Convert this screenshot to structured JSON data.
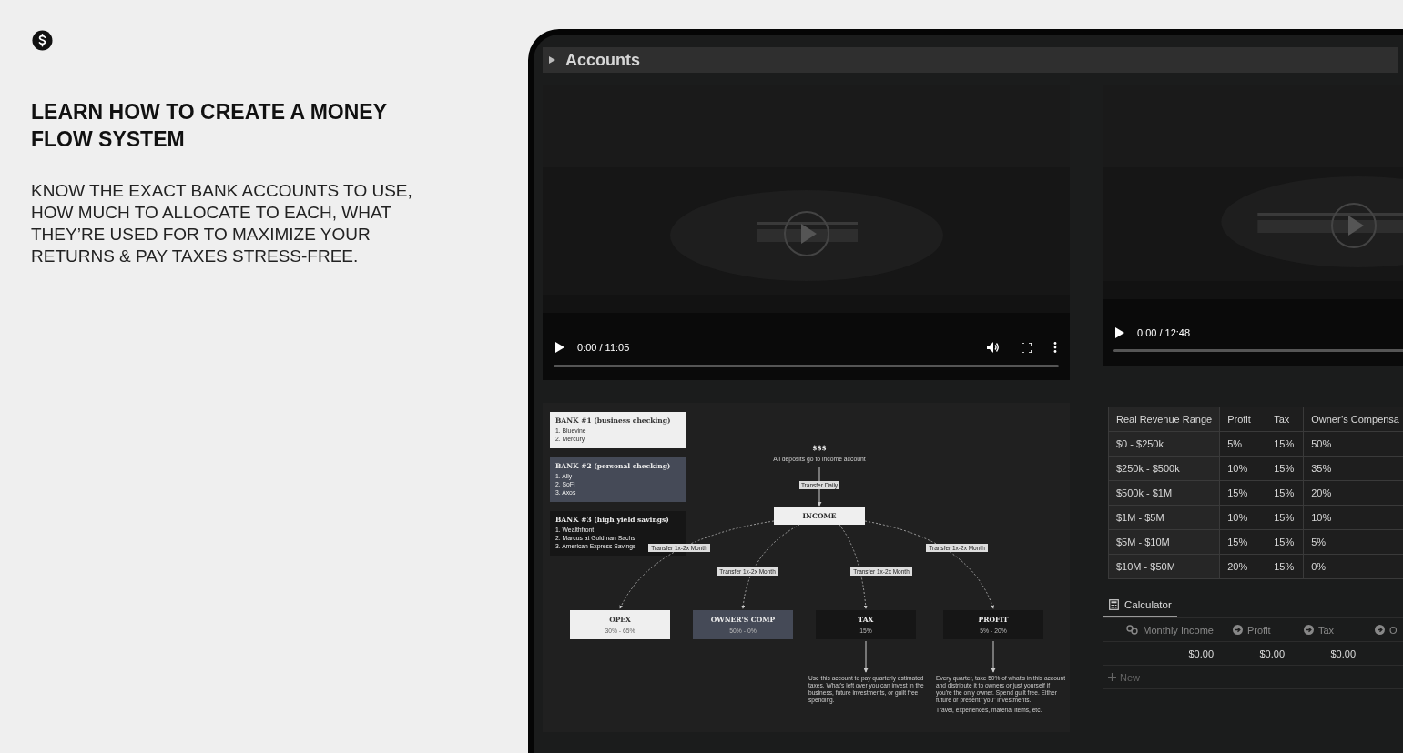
{
  "intro": {
    "heading": "LEARN HOW TO CREATE A MONEY FLOW SYSTEM",
    "body": "KNOW THE EXACT BANK ACCOUNTS TO USE, HOW MUCH TO ALLOCATE TO EACH, WHAT THEY’RE USED FOR TO MAXIMIZE YOUR RETURNS & PAY TAXES STRESS-FREE."
  },
  "toggle": {
    "title": "Accounts",
    "expanded": false
  },
  "videos": [
    {
      "kind": "picture",
      "time": "0:00 / 11:05"
    },
    {
      "kind": "picture",
      "time": "0:00 / 12:48"
    }
  ],
  "diagram": {
    "banks": [
      {
        "title": "BANK #1 (business checking)",
        "kind": "light",
        "items": [
          "1. Bluevine",
          "2. Mercury"
        ]
      },
      {
        "title": "BANK #2 (personal checking)",
        "kind": "slate",
        "items": [
          "1. Ally",
          "2. SoFi",
          "3. Axos"
        ]
      },
      {
        "title": "BANK #3 (high yield savings)",
        "kind": "dark",
        "items": [
          "1. Wealthfront",
          "2. Marcus at Goldman Sachs",
          "3. American Express Savings"
        ]
      }
    ],
    "source": {
      "title": "$$$",
      "note": "All deposits go to income account",
      "transfer": "Transfer Daily"
    },
    "income": "INCOME",
    "nodes": [
      {
        "title": "OPEX",
        "range": "30% - 65%",
        "kind": "light",
        "transfer": "Transfer 1x-2x Month"
      },
      {
        "title": "OWNER'S COMP",
        "range": "50% - 0%",
        "kind": "slate",
        "transfer": "Transfer 1x-2x Month"
      },
      {
        "title": "TAX",
        "range": "15%",
        "kind": "dark",
        "transfer": "Transfer 1x-2x Month",
        "notes": [
          "Use this account to pay quarterly estimated taxes. What's left over you can invest in the business, future investments, or guilt free spending."
        ]
      },
      {
        "title": "PROFIT",
        "range": "5% - 20%",
        "kind": "dark",
        "transfer": "Transfer 1x-2x Month",
        "notes": [
          "Every quarter, take 50% of what's in this account and distribute it to owners or just yourself if you're the only owner. Spend guilt free. Either future or present \"you\" investments.",
          "Travel, experiences, material items, etc."
        ]
      }
    ]
  },
  "table": {
    "columns": [
      "Real Revenue Range",
      "Profit",
      "Tax",
      "Owner’s Compensa"
    ],
    "rows": [
      [
        "$0 - $250k",
        "5%",
        "15%",
        "50%"
      ],
      [
        "$250k - $500k",
        "10%",
        "15%",
        "35%"
      ],
      [
        "$500k - $1M",
        "15%",
        "15%",
        "20%"
      ],
      [
        "$1M - $5M",
        "10%",
        "15%",
        "10%"
      ],
      [
        "$5M - $10M",
        "15%",
        "15%",
        "5%"
      ],
      [
        "$10M - $50M",
        "20%",
        "15%",
        "0%"
      ]
    ]
  },
  "calculator": {
    "tab": "Calculator",
    "columns": [
      {
        "label": "Monthly Income",
        "kind": "rollup"
      },
      {
        "label": "Profit",
        "kind": "formula"
      },
      {
        "label": "Tax",
        "kind": "formula"
      },
      {
        "label": "O",
        "kind": "formula"
      }
    ],
    "values": [
      "$0.00",
      "$0.00",
      "$0.00"
    ],
    "new": "New"
  }
}
